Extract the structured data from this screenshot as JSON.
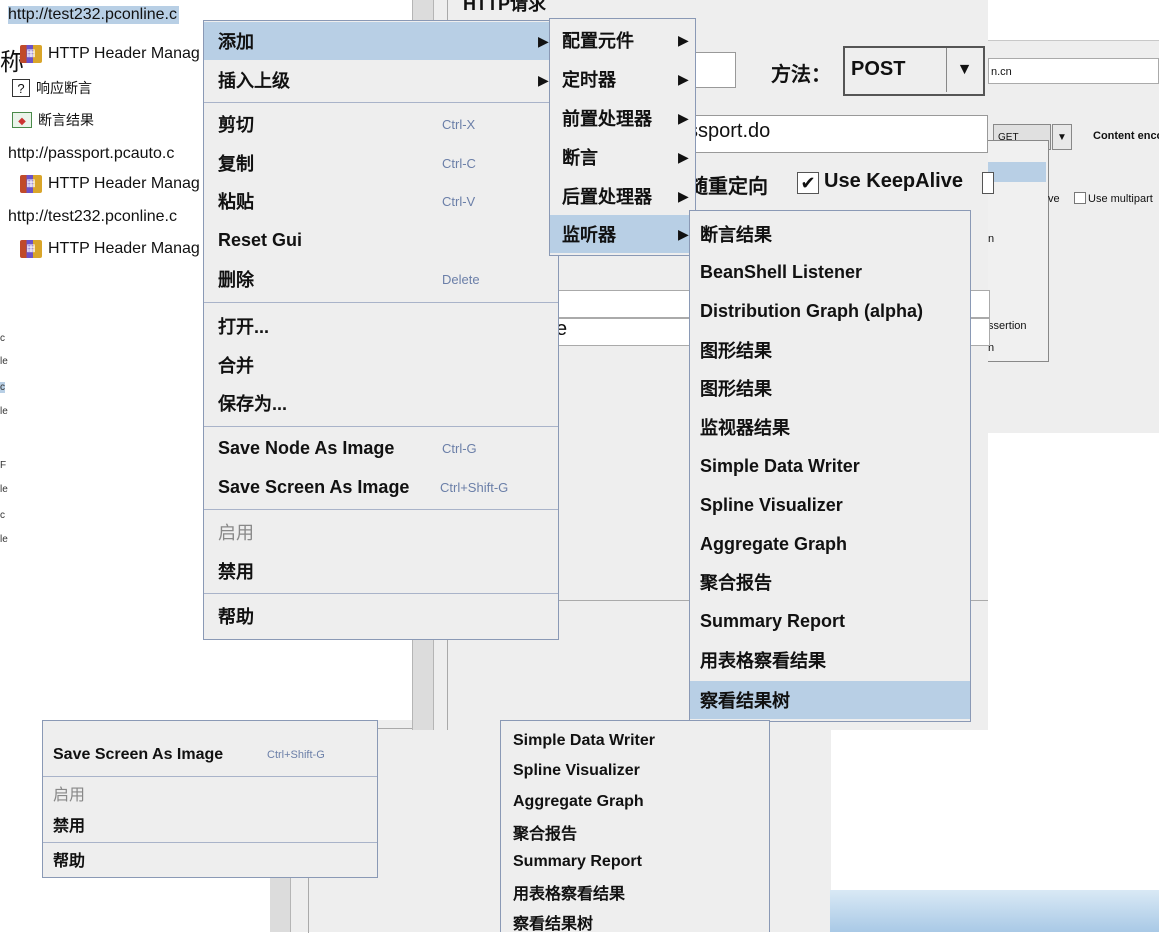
{
  "panel": {
    "title": "HTTP请求",
    "method_label": "方法：",
    "method_value": "POST",
    "path_text": "ssport.do",
    "redirect_label": "随重定向",
    "keepalive_label": "Use KeepAlive",
    "param_text": "e"
  },
  "right_window": {
    "host_text": "n.cn",
    "method_value": "GET",
    "content_encoding": "Content enco",
    "ve_text": "ve",
    "multipart_label": "Use multipart",
    "n_text_1": "n",
    "assertion_text": "ssertion",
    "n_text_2": "n"
  },
  "tree": {
    "items": [
      {
        "label": "http://test232.pconline.c"
      },
      {
        "label": "HTTP Header Manag"
      },
      {
        "label": "响应断言"
      },
      {
        "label": "断言结果"
      },
      {
        "label": "http://passport.pcauto.c"
      },
      {
        "label": "HTTP Header Manag"
      },
      {
        "label": "http://test232.pconline.c"
      },
      {
        "label": "HTTP Header Manag"
      }
    ],
    "side_glyph": "称",
    "fragments": [
      "c",
      "le",
      "c",
      "le",
      "F",
      "le",
      "c",
      "le"
    ]
  },
  "menu_main": {
    "items": [
      {
        "label": "添加",
        "shortcut": ""
      },
      {
        "label": "插入上级",
        "shortcut": ""
      },
      {
        "label": "剪切",
        "shortcut": "Ctrl-X"
      },
      {
        "label": "复制",
        "shortcut": "Ctrl-C"
      },
      {
        "label": "粘贴",
        "shortcut": "Ctrl-V"
      },
      {
        "label": "Reset Gui",
        "shortcut": ""
      },
      {
        "label": "删除",
        "shortcut": "Delete"
      },
      {
        "label": "打开...",
        "shortcut": ""
      },
      {
        "label": "合并",
        "shortcut": ""
      },
      {
        "label": "保存为...",
        "shortcut": ""
      },
      {
        "label": "Save Node As Image",
        "shortcut": "Ctrl-G"
      },
      {
        "label": "Save Screen As Image",
        "shortcut": "Ctrl+Shift-G"
      },
      {
        "label": "启用",
        "shortcut": ""
      },
      {
        "label": "禁用",
        "shortcut": ""
      },
      {
        "label": "帮助",
        "shortcut": ""
      }
    ],
    "arrow": "▶"
  },
  "menu_add": {
    "items": [
      {
        "label": "配置元件"
      },
      {
        "label": "定时器"
      },
      {
        "label": "前置处理器"
      },
      {
        "label": "断言"
      },
      {
        "label": "后置处理器"
      },
      {
        "label": "监听器"
      }
    ],
    "arrow": "▶"
  },
  "menu_listeners": {
    "items": [
      {
        "label": "断言结果"
      },
      {
        "label": "BeanShell Listener"
      },
      {
        "label": "Distribution Graph (alpha)"
      },
      {
        "label": "图形结果"
      },
      {
        "label": "图形结果"
      },
      {
        "label": "监视器结果"
      },
      {
        "label": "Simple Data Writer"
      },
      {
        "label": "Spline Visualizer"
      },
      {
        "label": "Aggregate Graph"
      },
      {
        "label": "聚合报告"
      },
      {
        "label": "Summary Report"
      },
      {
        "label": "用表格察看结果"
      },
      {
        "label": "察看结果树"
      }
    ]
  },
  "menu_main_copy": {
    "items": [
      {
        "label": "Save Screen As Image",
        "shortcut": "Ctrl+Shift-G"
      },
      {
        "label": "启用",
        "shortcut": ""
      },
      {
        "label": "禁用",
        "shortcut": ""
      },
      {
        "label": "帮助",
        "shortcut": ""
      }
    ]
  },
  "menu_listeners_copy": {
    "items": [
      {
        "label": "Simple Data Writer"
      },
      {
        "label": "Spline Visualizer"
      },
      {
        "label": "Aggregate Graph"
      },
      {
        "label": "聚合报告"
      },
      {
        "label": "Summary Report"
      },
      {
        "label": "用表格察看结果"
      },
      {
        "label": "察看结果树"
      }
    ]
  },
  "colors": {
    "menu_bg": "#eeeeee",
    "highlight": "#b8cfe5",
    "shortcut": "#6b7fa8"
  }
}
